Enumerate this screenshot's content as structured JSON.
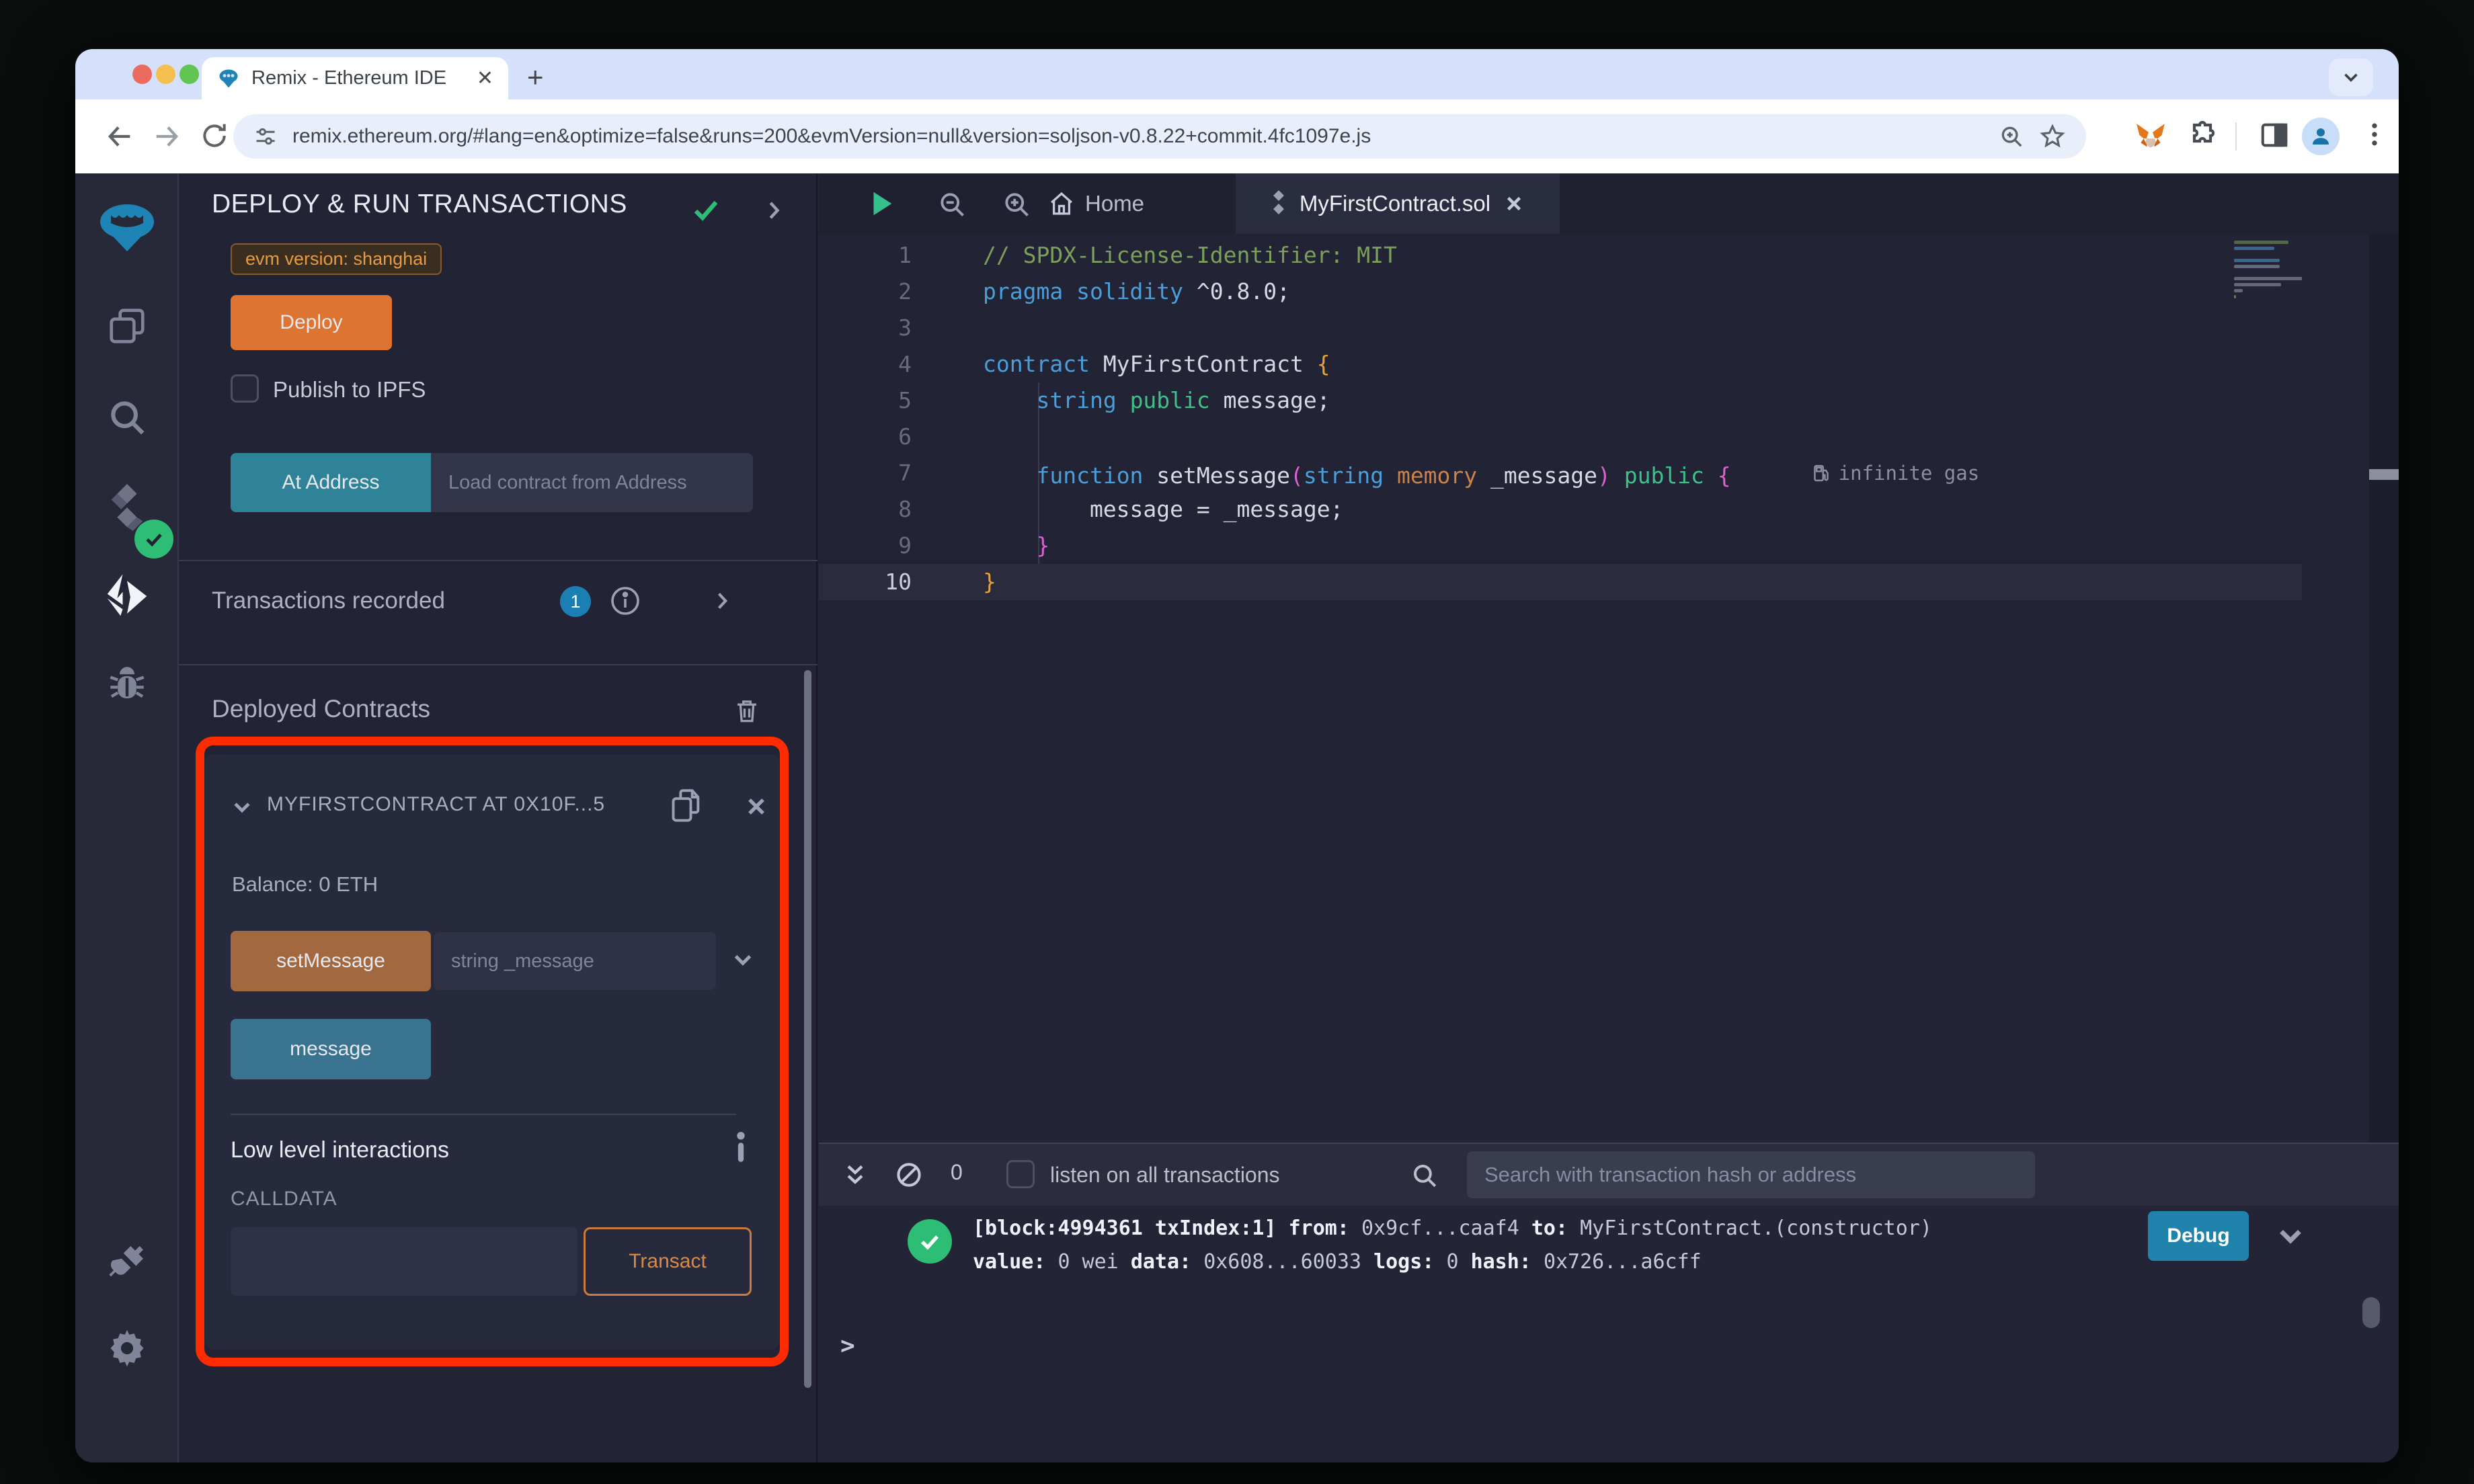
{
  "browser": {
    "tab_title": "Remix - Ethereum IDE",
    "url": "remix.ethereum.org/#lang=en&optimize=false&runs=200&evmVersion=null&version=soljson-v0.8.22+commit.4fc1097e.js"
  },
  "side_panel": {
    "title": "DEPLOY & RUN TRANSACTIONS",
    "evm_badge": "evm version: shanghai",
    "deploy_button": "Deploy",
    "publish_label": "Publish to IPFS",
    "at_address_button": "At Address",
    "at_address_placeholder": "Load contract from Address",
    "transactions_recorded_label": "Transactions recorded",
    "transactions_count": "1",
    "deployed_contracts_label": "Deployed Contracts",
    "contract": {
      "title": "MYFIRSTCONTRACT AT 0X10F...5",
      "balance": "Balance: 0 ETH",
      "set_message_button": "setMessage",
      "set_message_placeholder": "string _message",
      "message_button": "message",
      "low_level_label": "Low level interactions",
      "calldata_label": "CALLDATA",
      "transact_button": "Transact"
    }
  },
  "editor": {
    "home_tab": "Home",
    "file_tab": "MyFirstContract.sol",
    "gas_annotation": "infinite gas",
    "code_lines": [
      {
        "tokens": [
          [
            "// SPDX-License-Identifier: MIT",
            "comment"
          ]
        ]
      },
      {
        "tokens": [
          [
            "pragma solidity",
            "kw"
          ],
          [
            " ^0.8.0;",
            "plain"
          ]
        ]
      },
      {
        "tokens": []
      },
      {
        "tokens": [
          [
            "contract ",
            "kw"
          ],
          [
            "MyFirstContract ",
            "plain"
          ],
          [
            "{",
            "by"
          ]
        ]
      },
      {
        "tokens": [
          [
            "    ",
            "plain"
          ],
          [
            "string ",
            "kw"
          ],
          [
            "public ",
            "green"
          ],
          [
            "message;",
            "plain"
          ]
        ]
      },
      {
        "tokens": []
      },
      {
        "tokens": [
          [
            "    ",
            "plain"
          ],
          [
            "function ",
            "kw"
          ],
          [
            "setMessage",
            "plain"
          ],
          [
            "(",
            "bp"
          ],
          [
            "string",
            "kw"
          ],
          [
            " memory",
            "orange"
          ],
          [
            " _message",
            "plain"
          ],
          [
            ")",
            "bp"
          ],
          [
            " public",
            "green"
          ],
          [
            " {",
            "bp"
          ]
        ],
        "gas": true
      },
      {
        "tokens": [
          [
            "        message = _message;",
            "plain"
          ]
        ]
      },
      {
        "tokens": [
          [
            "    ",
            "plain"
          ],
          [
            "}",
            "bp"
          ]
        ]
      },
      {
        "tokens": [
          [
            "}",
            "by"
          ]
        ]
      }
    ],
    "active_line": 10
  },
  "terminal": {
    "badge_count": "0",
    "listen_label": "listen on all transactions",
    "search_placeholder": "Search with transaction hash or address",
    "debug_button": "Debug",
    "prompt": ">",
    "log_lines": [
      [
        [
          "[block:4994361 txIndex:1] ",
          1
        ],
        [
          "from: ",
          1
        ],
        [
          "0x9cf...caaf4 ",
          0
        ],
        [
          "to: ",
          1
        ],
        [
          "MyFirstContract.(constructor) ",
          0
        ]
      ],
      [
        [
          "value: ",
          1
        ],
        [
          "0 wei ",
          0
        ],
        [
          "data: ",
          1
        ],
        [
          "0x608...60033 ",
          0
        ],
        [
          "logs: ",
          1
        ],
        [
          "0 ",
          0
        ],
        [
          "hash: ",
          1
        ],
        [
          "0x726...a6cff",
          0
        ]
      ]
    ]
  },
  "colors": {
    "deploy_orange": "#dd7431",
    "at_address_teal": "#2e8399",
    "set_message_brown": "#a2683f",
    "message_blue": "#3a7390",
    "debug_blue": "#2083ac",
    "transact_orange": "#d98b45",
    "highlight_red": "#fe2c00",
    "success_green": "#2ebd74",
    "badge_blue": "#1b7fb4",
    "panel_bg": "#222334",
    "card_bg": "#272a3c"
  }
}
